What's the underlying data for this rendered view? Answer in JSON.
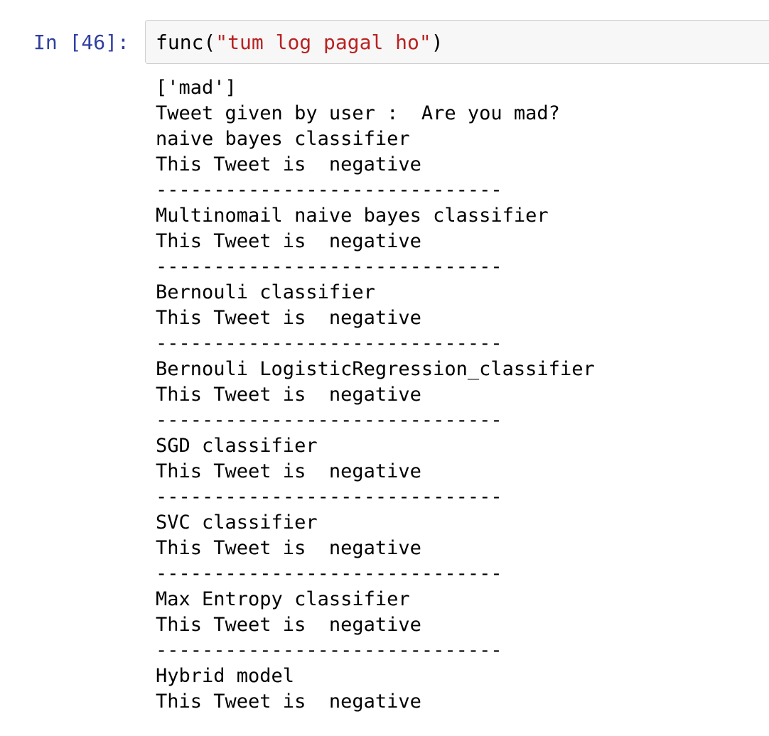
{
  "cell": {
    "prompt": "In [46]:",
    "code": {
      "call_open": "func(",
      "string_arg": "\"tum log pagal ho\"",
      "call_close": ")"
    }
  },
  "output": {
    "lines": [
      "['mad']",
      "Tweet given by user :  Are you mad?",
      "naive bayes classifier",
      "This Tweet is  negative",
      "------------------------------",
      "Multinomail naive bayes classifier",
      "This Tweet is  negative",
      "------------------------------",
      "Bernouli classifier",
      "This Tweet is  negative",
      "------------------------------",
      "Bernouli LogisticRegression_classifier",
      "This Tweet is  negative",
      "------------------------------",
      "SGD classifier",
      "This Tweet is  negative",
      "------------------------------",
      "SVC classifier",
      "This Tweet is  negative",
      "------------------------------",
      "Max Entropy classifier",
      "This Tweet is  negative",
      "------------------------------",
      "Hybrid model",
      "This Tweet is  negative"
    ]
  },
  "colors": {
    "prompt": "#303f9f",
    "string_literal": "#ba2121",
    "cell_background": "#f7f7f7",
    "cell_border": "#cfcfcf"
  }
}
